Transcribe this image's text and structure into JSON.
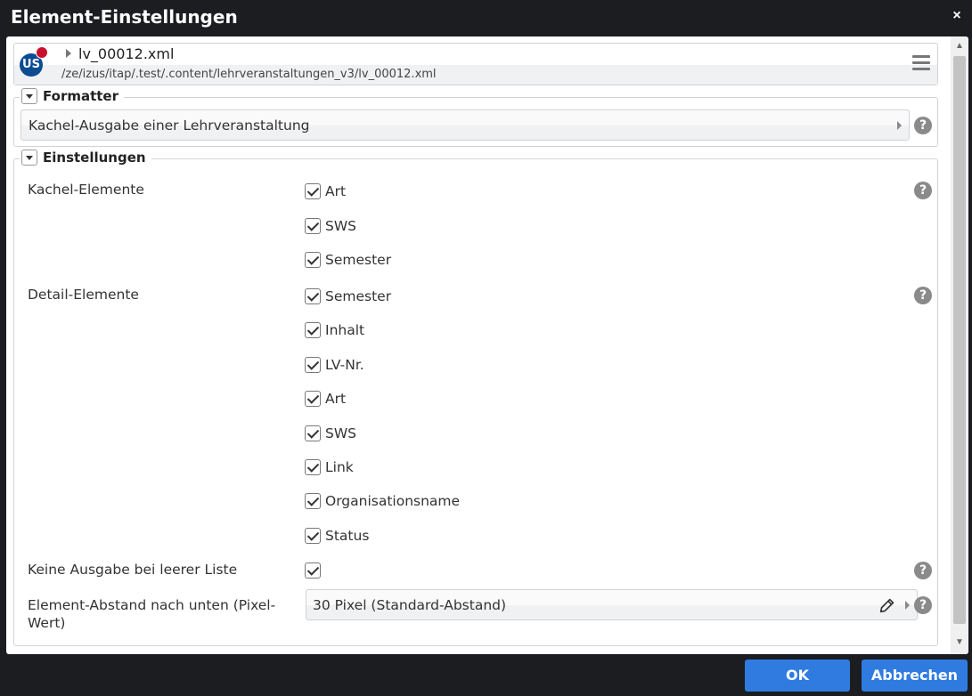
{
  "dialog": {
    "title": "Element-Einstellungen",
    "close_glyph": "×"
  },
  "resource": {
    "avatar_text": "US",
    "name": "lv_00012.xml",
    "path": "/ze/izus/itap/.test/.content/lehrveranstaltungen_v3/lv_00012.xml"
  },
  "formatter": {
    "legend": "Formatter",
    "value": "Kachel-Ausgabe einer Lehrveranstaltung"
  },
  "settings": {
    "legend": "Einstellungen",
    "kachel": {
      "label": "Kachel-Elemente",
      "items": [
        {
          "label": "Art",
          "checked": true
        },
        {
          "label": "SWS",
          "checked": true
        },
        {
          "label": "Semester",
          "checked": true
        }
      ]
    },
    "detail": {
      "label": "Detail-Elemente",
      "items": [
        {
          "label": "Semester",
          "checked": true
        },
        {
          "label": "Inhalt",
          "checked": true
        },
        {
          "label": "LV-Nr.",
          "checked": true
        },
        {
          "label": "Art",
          "checked": true
        },
        {
          "label": "SWS",
          "checked": true
        },
        {
          "label": "Link",
          "checked": true
        },
        {
          "label": "Organisationsname",
          "checked": true
        },
        {
          "label": "Status",
          "checked": true
        }
      ]
    },
    "empty_list": {
      "label": "Keine Ausgabe bei leerer Liste",
      "checked": true
    },
    "spacing": {
      "label": "Element-Abstand nach unten (Pixel-Wert)",
      "label_line1": "Element-Abstand nach unten (Pixel-",
      "label_line2": "Wert)",
      "value": "30 Pixel (Standard-Abstand)"
    },
    "help_glyph": "?"
  },
  "footer": {
    "ok_label": "OK",
    "cancel_label": "Abbrechen"
  },
  "colors": {
    "title_bar": "#1b1d21",
    "button_primary": "#2f7be0",
    "avatar": "#0b4c93",
    "notification_dot": "#c8102e"
  }
}
